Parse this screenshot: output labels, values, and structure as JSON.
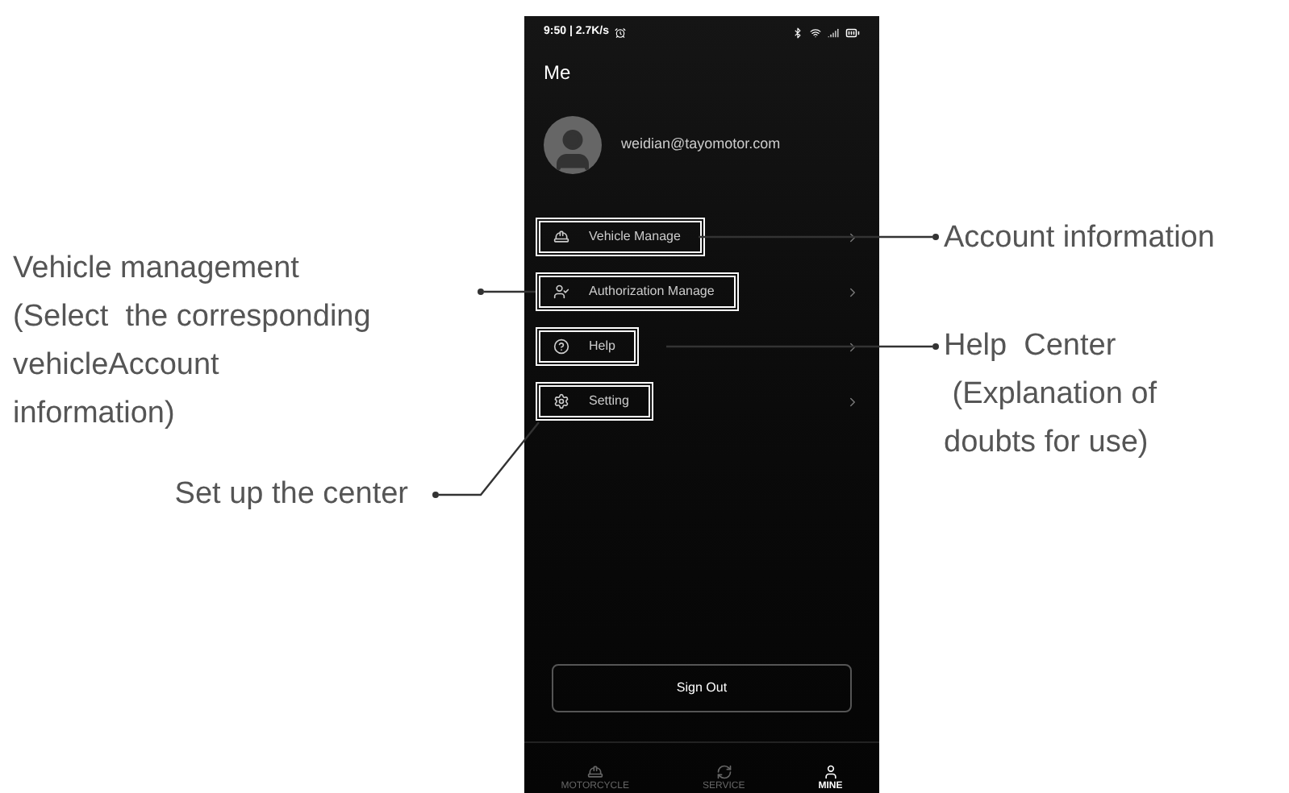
{
  "left_notes": {
    "vehicle_management": [
      "Vehicle management",
      "(Select  the corresponding",
      "vehicleAccount",
      "information)"
    ],
    "setting": "Set up the center"
  },
  "phone": {
    "status_bar": {
      "time": "9:50 | 2.7K/s"
    },
    "title": "Me",
    "profile": {
      "email": "weidian@tayomotor.com"
    },
    "menu": [
      {
        "kind": "vehicle",
        "label": "Vehicle Manage",
        "highlighted": true
      },
      {
        "kind": "authorization",
        "label": "Authorization Manage",
        "highlighted": true
      },
      {
        "kind": "help",
        "label": "Help",
        "highlighted": true
      },
      {
        "kind": "setting",
        "label": "Setting",
        "highlighted": true
      }
    ],
    "sign_out": "Sign Out",
    "nav": [
      {
        "kind": "motorcycle",
        "label": "MOTORCYCLE",
        "selected": false
      },
      {
        "kind": "service",
        "label": "SERVICE",
        "selected": false
      },
      {
        "kind": "mine",
        "label": "MINE",
        "selected": true
      }
    ]
  },
  "right_notes": {
    "account": "Account information",
    "help": [
      "Help  Center",
      " (Explanation of",
      "doubts for use)"
    ]
  }
}
